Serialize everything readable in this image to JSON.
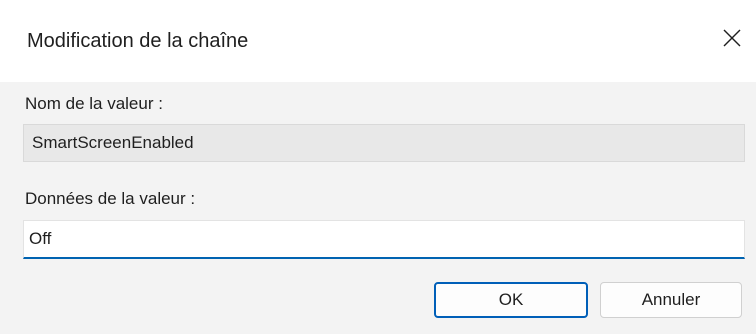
{
  "window": {
    "title": "Modification de la chaîne",
    "close_icon": "close-icon"
  },
  "value_name": {
    "label": "Nom de la valeur :",
    "value": "SmartScreenEnabled"
  },
  "value_data": {
    "label": "Données de la valeur :",
    "value": "Off"
  },
  "buttons": {
    "ok_label": "OK",
    "cancel_label": "Annuler"
  },
  "colors": {
    "accent": "#005fb8",
    "window_background": "#f3f3f3",
    "titlebar_background": "#ffffff",
    "readonly_field_background": "#e8e8e8"
  }
}
